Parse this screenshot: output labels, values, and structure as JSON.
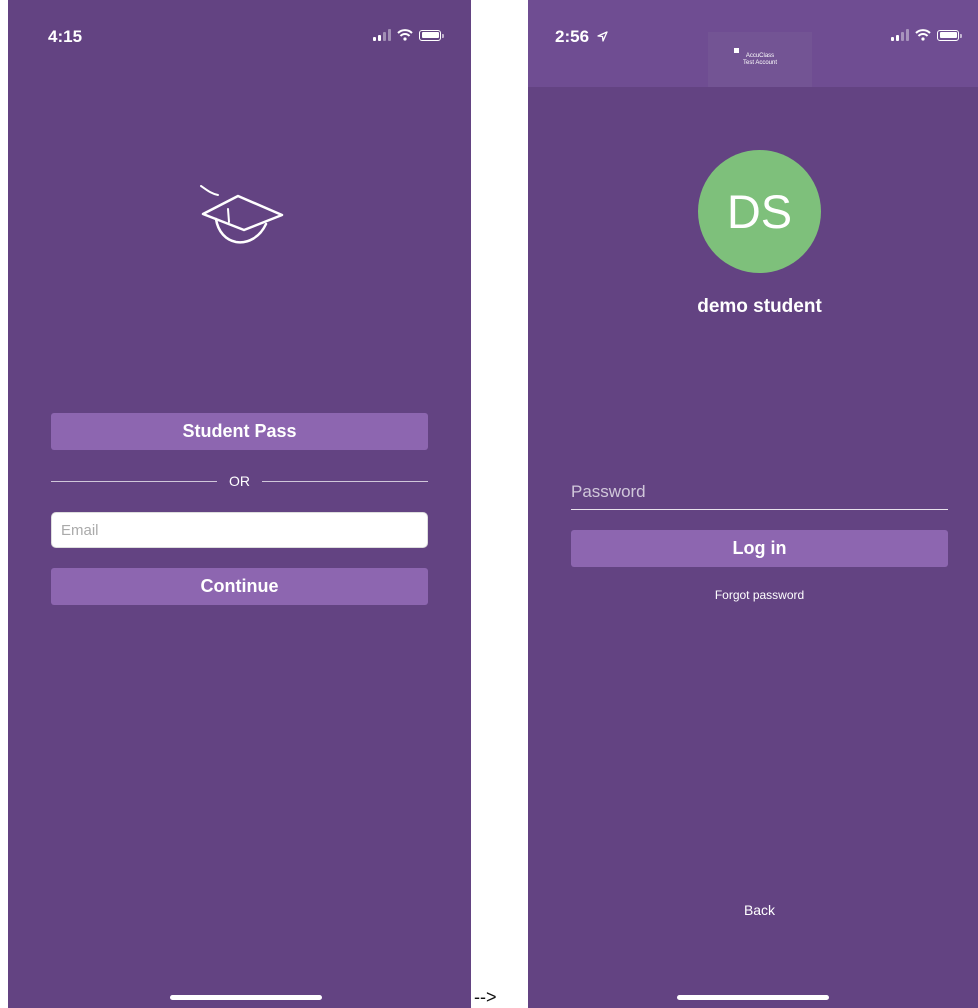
{
  "left_screen": {
    "status_time": "4:15",
    "student_pass_label": "Student Pass",
    "or_label": "OR",
    "email_placeholder": "Email",
    "continue_label": "Continue"
  },
  "transition_arrow": "-->",
  "right_screen": {
    "status_time": "2:56",
    "account_badge": [
      "AccuClass",
      "Test Account"
    ],
    "avatar_initials": "DS",
    "user_name": "demo student",
    "password_placeholder": "Password",
    "login_label": "Log in",
    "forgot_password_label": "Forgot password",
    "back_label": "Back"
  },
  "colors": {
    "background": "#634382",
    "button": "#8d66b0",
    "avatar": "#7ec07b"
  },
  "icons": [
    "graduation-cap-icon",
    "signal-icon",
    "wifi-icon",
    "battery-icon",
    "location-arrow-icon"
  ]
}
